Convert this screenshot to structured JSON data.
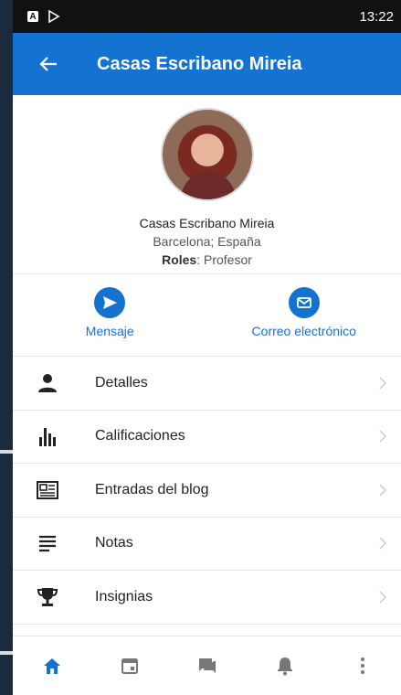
{
  "status_bar": {
    "time": "13:22"
  },
  "header": {
    "title": "Casas Escribano Mireia"
  },
  "profile": {
    "name": "Casas Escribano Mireia",
    "location": "Barcelona; España",
    "roles_label": "Roles",
    "roles_value": ": Profesor"
  },
  "actions": [
    {
      "label": "Mensaje",
      "icon": "send-icon"
    },
    {
      "label": "Correo electrónico",
      "icon": "mail-icon"
    }
  ],
  "menu": [
    {
      "label": "Detalles",
      "icon": "person-icon"
    },
    {
      "label": "Calificaciones",
      "icon": "bar-chart-icon"
    },
    {
      "label": "Entradas del blog",
      "icon": "newspaper-icon"
    },
    {
      "label": "Notas",
      "icon": "notes-icon"
    },
    {
      "label": "Insignias",
      "icon": "trophy-icon"
    }
  ],
  "bottom_nav": [
    "home-icon",
    "calendar-icon",
    "messages-icon",
    "bell-icon",
    "more-icon"
  ],
  "colors": {
    "accent": "#1473d1",
    "text": "#222222"
  }
}
